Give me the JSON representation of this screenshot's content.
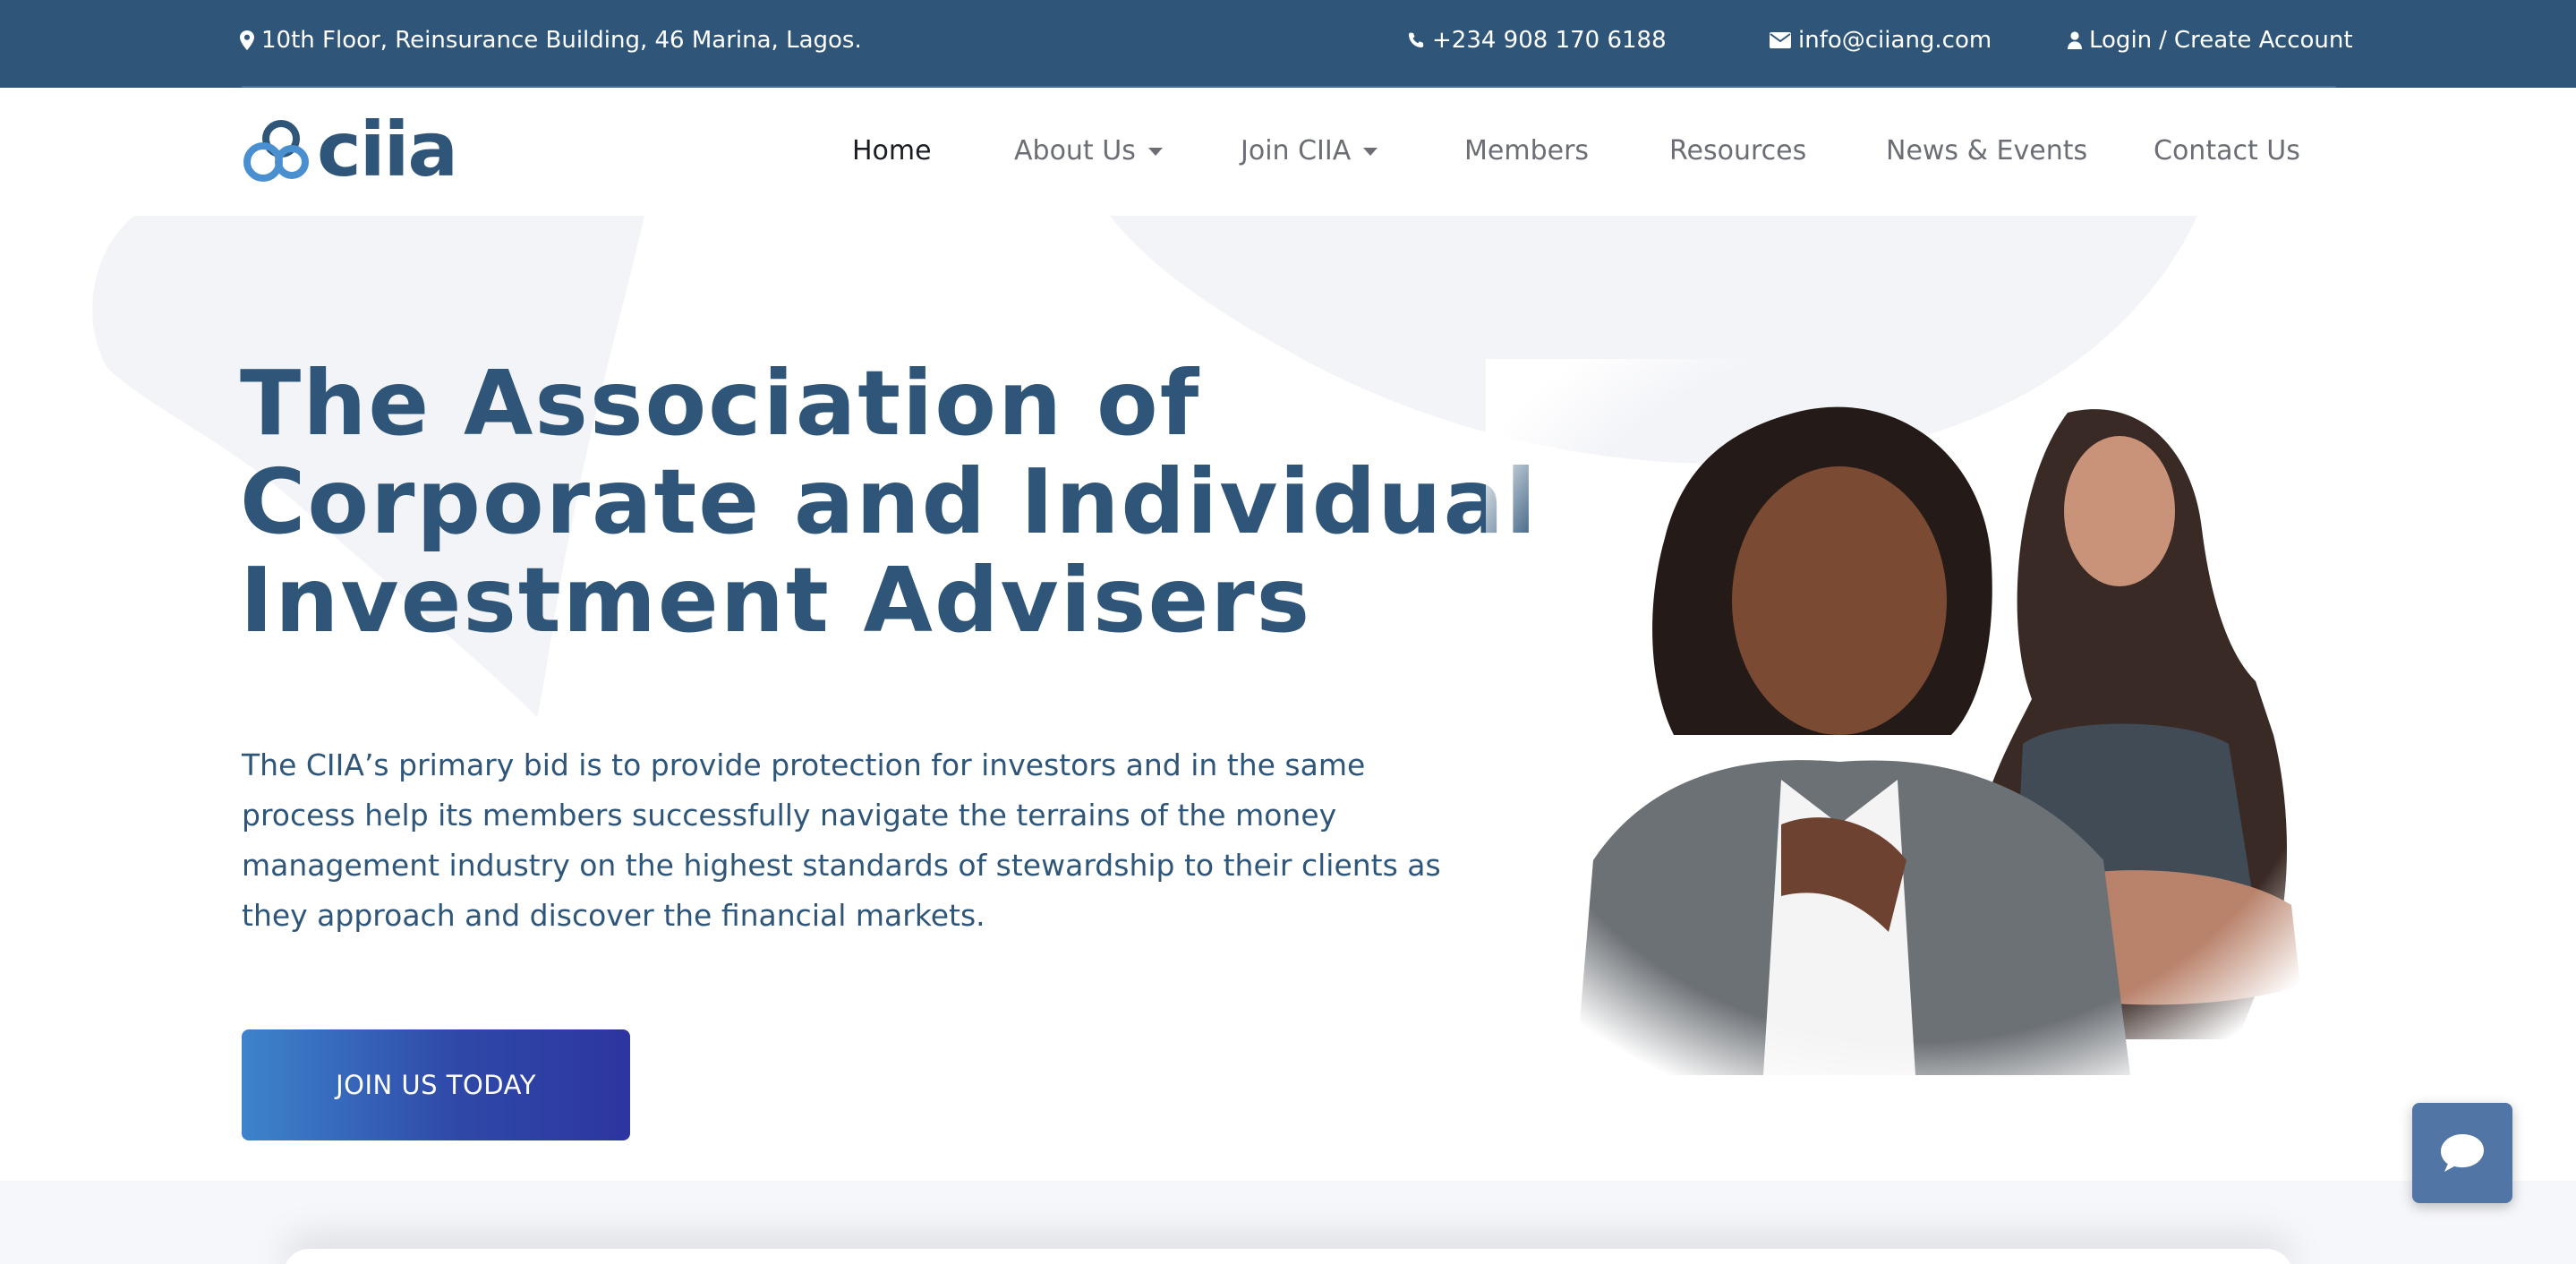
{
  "topbar": {
    "address": "10th Floor, Reinsurance Building, 46 Marina, Lagos.",
    "phone": "+234 908 170 6188",
    "email": "info@ciiang.com",
    "login": "Login",
    "separator": "/",
    "create_account": "Create Account",
    "icons": [
      "map-marker-icon",
      "phone-icon",
      "envelope-icon",
      "user-icon"
    ]
  },
  "logo": {
    "text": "ciia"
  },
  "nav": {
    "items": [
      {
        "label": "Home",
        "active": true,
        "dropdown": false
      },
      {
        "label": "About Us",
        "active": false,
        "dropdown": true
      },
      {
        "label": "Join CIIA",
        "active": false,
        "dropdown": true
      },
      {
        "label": "Members",
        "active": false,
        "dropdown": false
      },
      {
        "label": "Resources",
        "active": false,
        "dropdown": false
      },
      {
        "label": "News & Events",
        "active": false,
        "dropdown": false
      },
      {
        "label": "Contact Us",
        "active": false,
        "dropdown": false
      }
    ]
  },
  "hero": {
    "title_lines": [
      "The Association of",
      "Corporate and Individual",
      "Investment Advisers"
    ],
    "description": "The CIIA’s primary bid is to provide protection for investors and in the same process help its members successfully navigate the terrains of the money management industry on the highest standards of stewardship to their clients as they approach and discover the financial markets.",
    "cta_label": "JOIN US TODAY"
  },
  "chat": {
    "icon": "chat-bubble-icon"
  },
  "colors": {
    "topbar_bg": "#2f5678",
    "brand_navy": "#2f5678",
    "cta_gradient_start": "#3d84cc",
    "cta_gradient_end": "#2d35a0",
    "chat_bg": "#5175a4"
  }
}
